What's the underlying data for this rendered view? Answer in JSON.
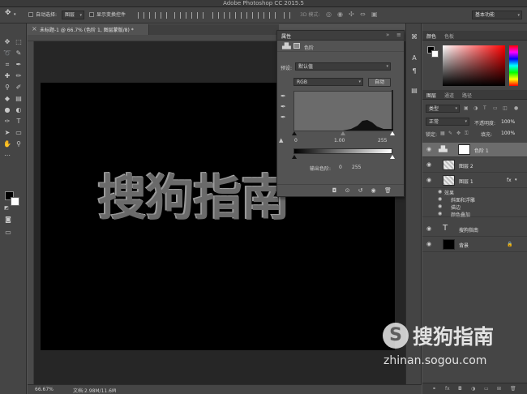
{
  "app": {
    "window_title": "Adobe Photoshop CC 2015.5"
  },
  "options_bar": {
    "auto_select_label": "自动选择:",
    "auto_select_target": "图层",
    "show_transform_label": "显示变换控件",
    "mode_3d_label": "3D 模式:",
    "workspace": "基本功能"
  },
  "document": {
    "tab_label": "未标题-1 @ 66.7% (色阶 1, 图层蒙版/8) *",
    "canvas_text": "搜狗指南",
    "zoom": "66.67%",
    "doc_info": "文档:2.98M/11.6M"
  },
  "properties": {
    "panel_title": "属性",
    "adjustment_name": "色阶",
    "preset_label": "预设:",
    "preset_value": "默认值",
    "channel": "RGB",
    "auto_button": "自动",
    "input_black": "0",
    "input_gamma": "1.00",
    "input_white": "255",
    "output_label": "输出色阶:",
    "output_black": "0",
    "output_white": "255"
  },
  "color_panel": {
    "tabs": [
      "颜色",
      "色板"
    ]
  },
  "layers_panel": {
    "tabs": [
      "图层",
      "通道",
      "路径"
    ],
    "kind_filter": "类型",
    "blend_mode": "正常",
    "opacity_label": "不透明度:",
    "opacity_value": "100%",
    "lock_label": "锁定:",
    "fill_label": "填充:",
    "fill_value": "100%",
    "layers": [
      {
        "name": "色阶 1"
      },
      {
        "name": "图层 2"
      },
      {
        "name": "图层 1",
        "fx": "fx"
      },
      {
        "name": "搜狗指南"
      },
      {
        "name": "背景"
      }
    ],
    "effects_label": "效果",
    "effects": [
      "斜面和浮雕",
      "描边",
      "颜色叠加"
    ]
  },
  "watermark": {
    "logo_letter": "S",
    "brand": "搜狗指南",
    "url": "zhinan.sogou.com"
  }
}
